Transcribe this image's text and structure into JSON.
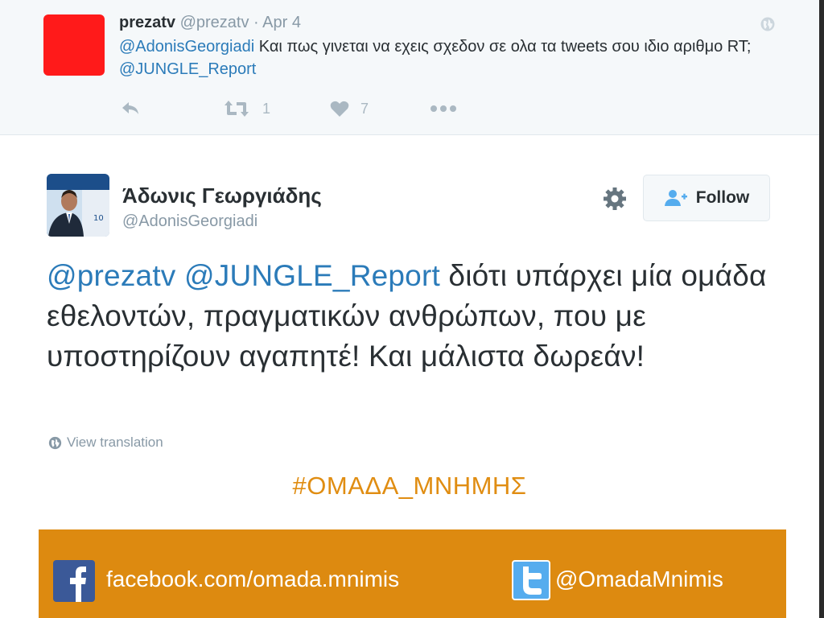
{
  "parent_tweet": {
    "author_name": "prezatv",
    "handle": "@prezatv",
    "separator": "·",
    "date": "Apr 4",
    "mention_1": "@AdonisGeorgiadi",
    "text_part_1": " Και πως γινεται να εχεις σχεδον σε ολα τα tweets σου ιδιο αριθμο RT; ",
    "mention_2": "@JUNGLE_Report",
    "retweet_count": "1",
    "like_count": "7",
    "avatar_color": "#ff1a1a"
  },
  "main_tweet": {
    "author_name": "Άδωνις Γεωργιάδης",
    "handle": "@AdonisGeorgiadi",
    "follow_label": "Follow",
    "mention_1": "@prezatv",
    "mention_2": "@JUNGLE_Report",
    "text": " διότι υπάρχει μία ομάδα εθελοντών, πραγματικών ανθρώπων, που με υποστηρίζουν αγαπητέ! Και μάλιστα δωρεάν!",
    "translate_label": "View translation"
  },
  "overlay": {
    "hashtag": "#ΟΜΑΔΑ_ΜΝΗΜΗΣ",
    "facebook_text": "facebook.com/omada.mnimis",
    "twitter_text": "@OmadaMnimis",
    "banner_color": "#dd8a10",
    "hashtag_color": "#e08d12"
  },
  "icons": {
    "reply": "reply-icon",
    "retweet": "retweet-icon",
    "like": "heart-icon",
    "more": "more-dots-icon",
    "globe": "globe-icon",
    "gear": "gear-icon",
    "follow": "add-user-icon",
    "facebook": "facebook-icon",
    "twitter": "twitter-icon"
  }
}
